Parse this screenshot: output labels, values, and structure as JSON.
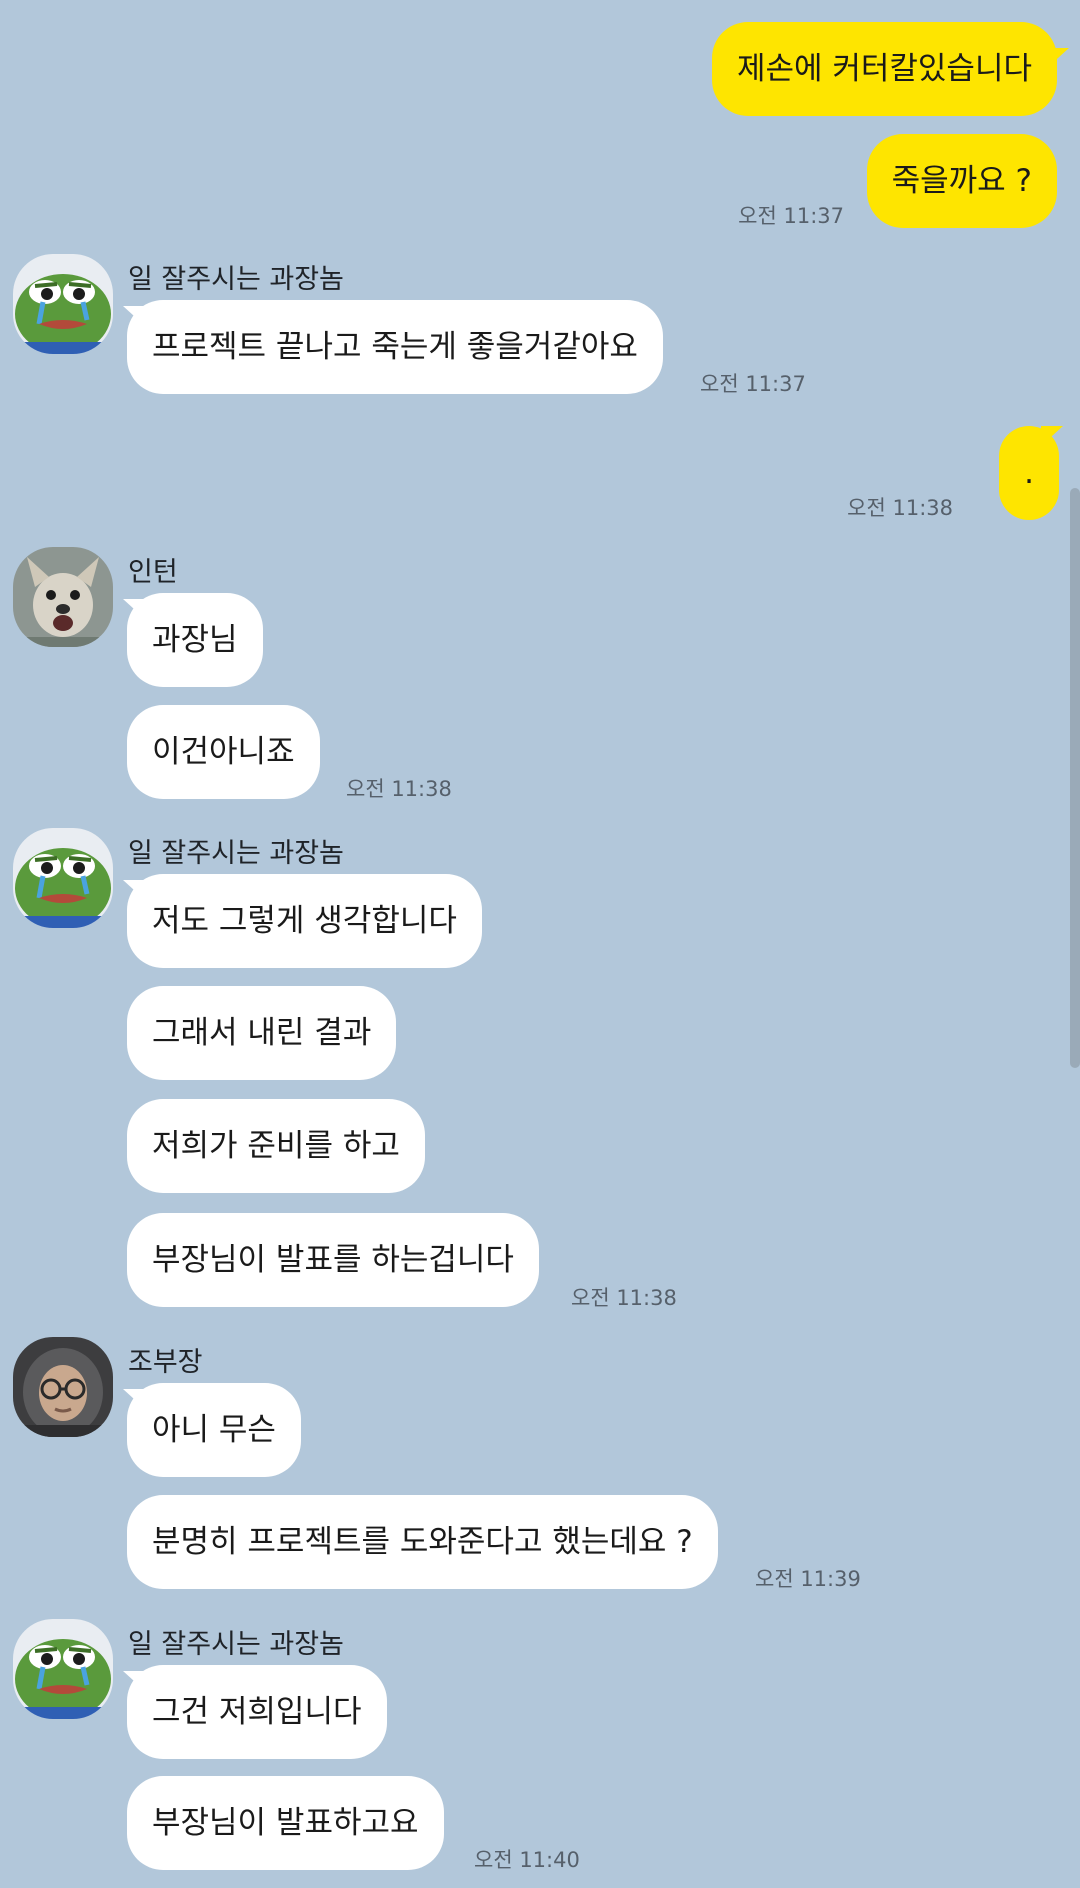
{
  "chat": {
    "senders": {
      "manager": "일 잘주시는 과장놈",
      "intern": "인턴",
      "director": "조부장"
    },
    "messages": [
      {
        "from": "me",
        "text": "제손에 커터칼있습니다"
      },
      {
        "from": "me",
        "text": "죽을까요 ?",
        "time": "오전 11:37"
      },
      {
        "from": "manager",
        "text": "프로젝트 끝나고 죽는게 좋을거같아요",
        "time": "오전 11:37"
      },
      {
        "from": "me",
        "text": ".",
        "time": "오전 11:38"
      },
      {
        "from": "intern",
        "text": "과장님"
      },
      {
        "from": "intern",
        "text": "이건아니죠",
        "time": "오전 11:38"
      },
      {
        "from": "manager",
        "text": "저도 그렇게 생각합니다"
      },
      {
        "from": "manager",
        "text": "그래서 내린 결과"
      },
      {
        "from": "manager",
        "text": "저희가 준비를 하고"
      },
      {
        "from": "manager",
        "text": "부장님이 발표를 하는겁니다",
        "time": "오전 11:38"
      },
      {
        "from": "director",
        "text": "아니 무슨"
      },
      {
        "from": "director",
        "text": "분명히 프로젝트를 도와준다고 했는데요 ?",
        "time": "오전 11:39"
      },
      {
        "from": "manager",
        "text": "그건 저희입니다"
      },
      {
        "from": "manager",
        "text": "부장님이 발표하고요",
        "time": "오전 11:40"
      }
    ]
  },
  "avatars": {
    "manager": "pepe-frog-crying",
    "intern": "chihuahua-dog",
    "director": "person-hood-glasses"
  },
  "colors": {
    "background": "#b2c7da",
    "my_bubble": "#fee500",
    "other_bubble": "#ffffff",
    "time_text": "#56606b"
  }
}
